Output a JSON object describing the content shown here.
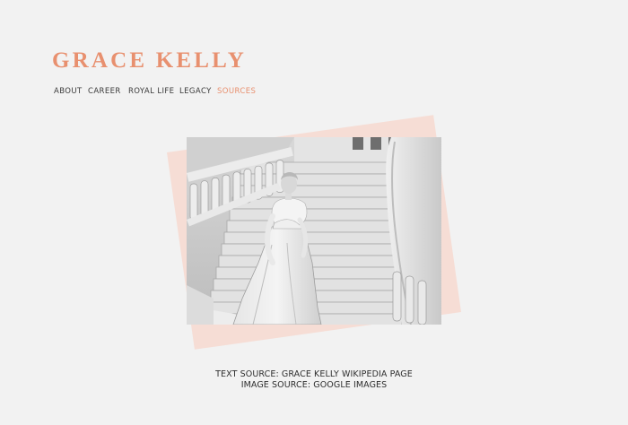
{
  "site": {
    "title": "GRACE KELLY",
    "accent_color": "#e8906f",
    "background_color": "#f2f2f2",
    "backdrop_color": "#f6ddd5"
  },
  "nav": {
    "items": [
      {
        "label": "ABOUT",
        "active": false
      },
      {
        "label": "CAREER",
        "active": false
      },
      {
        "label": "ROYAL LIFE",
        "active": false
      },
      {
        "label": "LEGACY",
        "active": false
      },
      {
        "label": "SOURCES",
        "active": true
      }
    ]
  },
  "photo": {
    "subject": "black-and-white photo of woman in gown on marble staircase"
  },
  "credits": {
    "text_source": "TEXT SOURCE: GRACE KELLY WIKIPEDIA PAGE",
    "image_source": "IMAGE SOURCE: GOOGLE IMAGES"
  }
}
